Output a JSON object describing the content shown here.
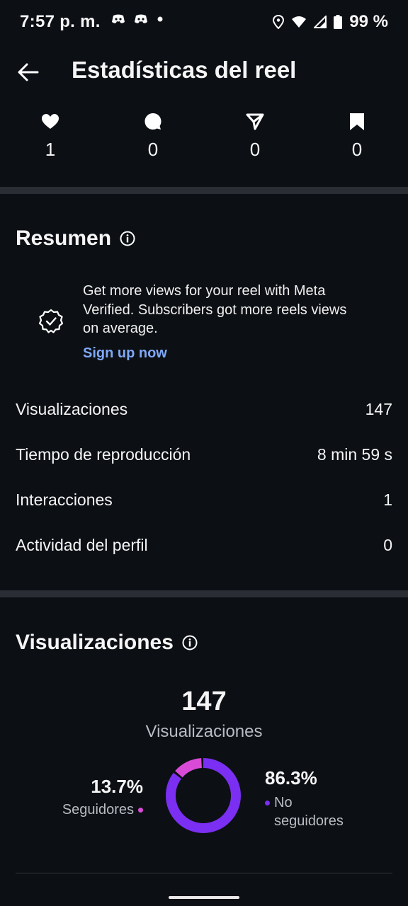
{
  "status_bar": {
    "time": "7:57 p. m.",
    "battery": "99 %"
  },
  "header": {
    "title": "Estadísticas del reel"
  },
  "engagement": [
    {
      "icon": "heart-icon",
      "value": "1"
    },
    {
      "icon": "comment-icon",
      "value": "0"
    },
    {
      "icon": "share-icon",
      "value": "0"
    },
    {
      "icon": "bookmark-icon",
      "value": "0"
    }
  ],
  "summary": {
    "title": "Resumen",
    "promo": {
      "text": "Get more views for your reel with Meta Verified. Subscribers got more reels views on average.",
      "link": "Sign up now"
    },
    "rows": [
      {
        "label": "Visualizaciones",
        "value": "147"
      },
      {
        "label": "Tiempo de reproducción",
        "value": "8 min 59 s"
      },
      {
        "label": "Interacciones",
        "value": "1"
      },
      {
        "label": "Actividad del perfil",
        "value": "0"
      }
    ]
  },
  "views": {
    "title": "Visualizaciones",
    "total": "147",
    "total_label": "Visualizaciones",
    "followers_pct": "13.7%",
    "followers_label": "Seguidores",
    "non_followers_pct": "86.3%",
    "non_followers_label": "No seguidores",
    "followers_fraction": 0.137,
    "colors": {
      "followers": "#d94bd6",
      "non_followers": "#7b2ff2"
    }
  }
}
